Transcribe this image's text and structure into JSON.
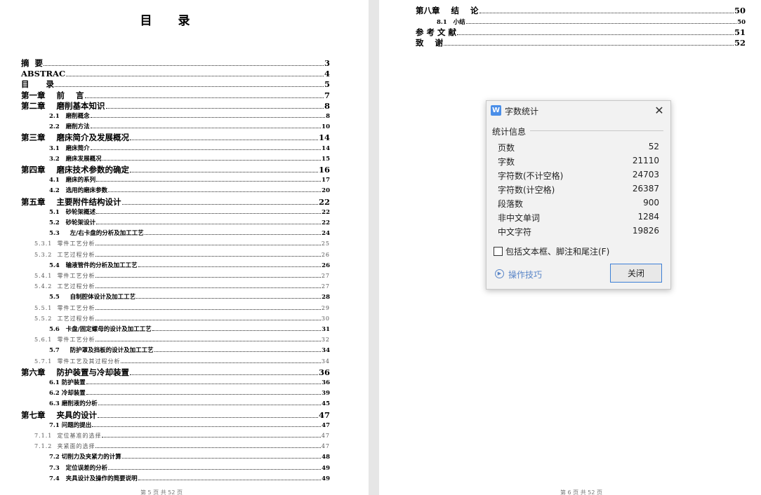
{
  "left_page": {
    "toc_title": "目　录",
    "footer": "第 5 页 共 52 页",
    "entries": [
      {
        "title": "摘  要",
        "page": "3",
        "level": 1
      },
      {
        "title": "ABSTRAC",
        "page": "4",
        "level": 1
      },
      {
        "title": "目      录",
        "page": "5",
        "level": 1
      },
      {
        "title": "第一章    前    言",
        "page": "7",
        "level": 1
      },
      {
        "title": "第二章    磨削基本知识",
        "page": "8",
        "level": 1
      },
      {
        "title": "2.1   磨削概念",
        "page": "8",
        "level": 2
      },
      {
        "title": "2.2   磨削方法",
        "page": "10",
        "level": 2
      },
      {
        "title": "第三章    磨床简介及发展概况",
        "page": "14",
        "level": 1
      },
      {
        "title": "3.1   磨床简介",
        "page": "14",
        "level": 2
      },
      {
        "title": "3.2   磨床发展概况",
        "page": "15",
        "level": 2
      },
      {
        "title": "第四章    磨床技术参数的确定",
        "page": "16",
        "level": 1
      },
      {
        "title": "4.1   磨床的系列",
        "page": "17",
        "level": 2
      },
      {
        "title": "4.2   选用的磨床参数",
        "page": "20",
        "level": 2
      },
      {
        "title": "第五章    主要附件结构设计",
        "page": "22",
        "level": 1
      },
      {
        "title": "5.1   砂轮架概述",
        "page": "22",
        "level": 2
      },
      {
        "title": "5.2   砂轮架设计",
        "page": "22",
        "level": 2
      },
      {
        "title": "5.3     左/右卡盘的分析及加工工艺",
        "page": "24",
        "level": 2
      },
      {
        "title": "5.3.1  零件工艺分析",
        "page": "25",
        "level": 3
      },
      {
        "title": "5.3.2  工艺过程分析",
        "page": "26",
        "level": 3
      },
      {
        "title": "5.4   输液管件的分析及加工工艺",
        "page": "26",
        "level": 2
      },
      {
        "title": "5.4.1  零件工艺分析",
        "page": "27",
        "level": 3
      },
      {
        "title": "5.4.2  工艺过程分析",
        "page": "27",
        "level": 3
      },
      {
        "title": "5.5     自制腔体设计及加工工艺",
        "page": "28",
        "level": 2
      },
      {
        "title": "5.5.1  零件工艺分析",
        "page": "29",
        "level": 3
      },
      {
        "title": "5.5.2  工艺过程分析",
        "page": "30",
        "level": 3
      },
      {
        "title": "5.6   卡盘/固定螺母的设计及加工工艺",
        "page": "31",
        "level": 2
      },
      {
        "title": "5.6.1  零件工艺分析",
        "page": "32",
        "level": 3
      },
      {
        "title": "5.7     防护罩及挡板的设计及加工工艺",
        "page": "34",
        "level": 2
      },
      {
        "title": "5.7.1  零件工艺及其过程分析",
        "page": "34",
        "level": 3
      },
      {
        "title": "第六章    防护装置与冷却装置",
        "page": "36",
        "level": 1
      },
      {
        "title": "6.1 防护装置",
        "page": "36",
        "level": 2
      },
      {
        "title": "6.2 冷却装置",
        "page": "39",
        "level": 2
      },
      {
        "title": "6.3 磨削液的分析",
        "page": "45",
        "level": 2
      },
      {
        "title": "第七章    夹具的设计",
        "page": "47",
        "level": 1
      },
      {
        "title": "7.1 问题的提出",
        "page": "47",
        "level": 2
      },
      {
        "title": "7.1.1  定位基准的选择",
        "page": "47",
        "level": 3
      },
      {
        "title": "7.1.2  夹紧面的选择",
        "page": "47",
        "level": 3
      },
      {
        "title": "7.2 切削力及夹紧力的计算",
        "page": "48",
        "level": 2
      },
      {
        "title": "7.3   定位误差的分析",
        "page": "49",
        "level": 2
      },
      {
        "title": "7.4   夹具设计及操作的简要说明",
        "page": "49",
        "level": 2
      }
    ]
  },
  "right_page": {
    "footer": "第 6 页 共 52 页",
    "entries": [
      {
        "title": "第八章    结    论",
        "page": "50",
        "level": 1
      },
      {
        "title": "8.1   小结",
        "page": "50",
        "level": 2
      },
      {
        "title": "参 考 文 献",
        "page": "51",
        "level": 1
      },
      {
        "title": "致    谢",
        "page": "52",
        "level": 1
      }
    ]
  },
  "dialog": {
    "title": "字数统计",
    "app_icon": "W",
    "close_glyph": "✕",
    "group_label": "统计信息",
    "stats": [
      {
        "label": "页数",
        "value": "52"
      },
      {
        "label": "字数",
        "value": "21110"
      },
      {
        "label": "字符数(不计空格)",
        "value": "24703"
      },
      {
        "label": "字符数(计空格)",
        "value": "26387"
      },
      {
        "label": "段落数",
        "value": "900"
      },
      {
        "label": "非中文单词",
        "value": "1284"
      },
      {
        "label": "中文字符",
        "value": "19826"
      }
    ],
    "checkbox_label": "包括文本框、脚注和尾注(F)",
    "checkbox_checked": false,
    "tips_label": "操作技巧",
    "close_button": "关闭",
    "icons": {
      "app": "wps-writer-icon",
      "close": "close-icon",
      "tips": "play-circle-icon"
    },
    "colors": {
      "accent": "#3c7fd6",
      "link": "#5a86c8",
      "app_icon": "#4a8ee8"
    }
  }
}
